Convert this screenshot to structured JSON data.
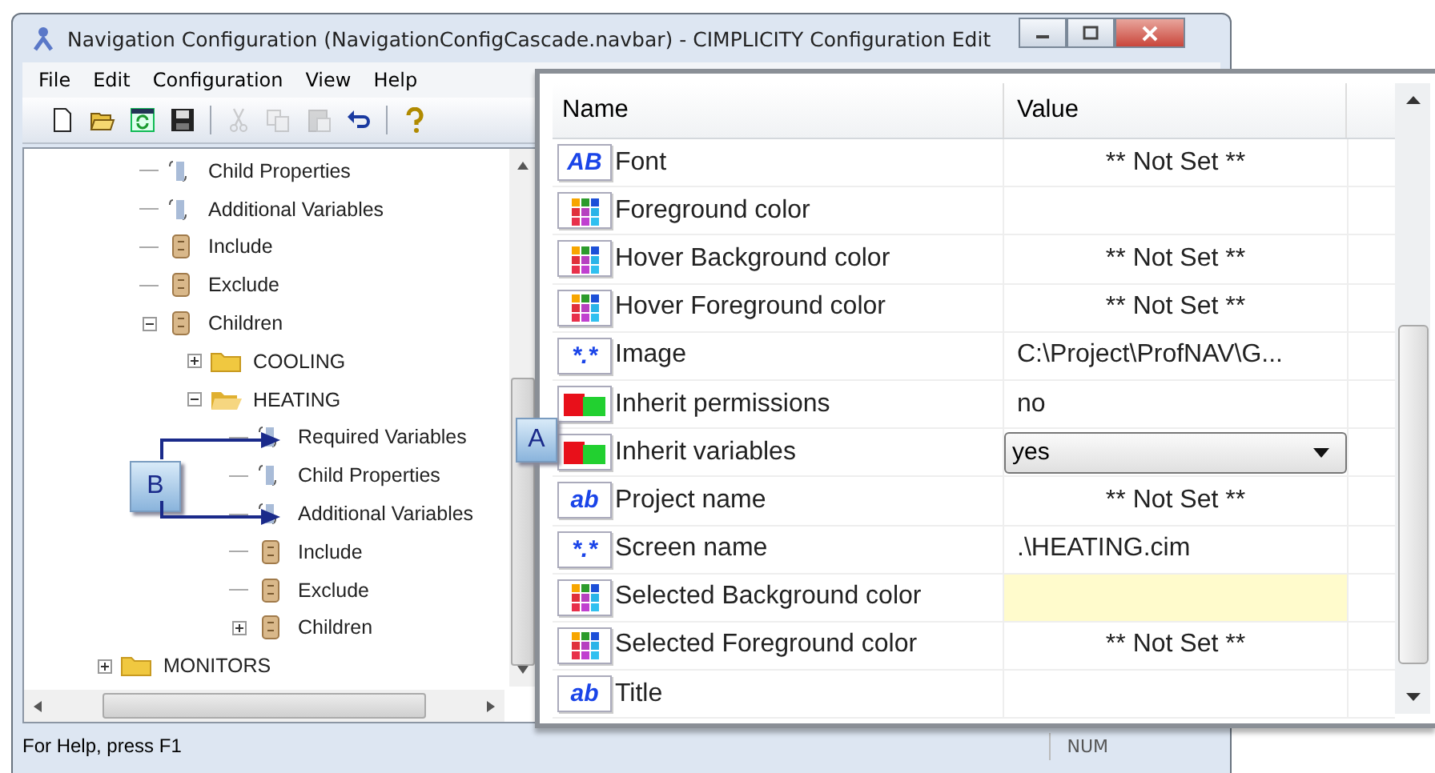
{
  "window": {
    "title": "Navigation Configuration (NavigationConfigCascade.navbar) - CIMPLICITY Configuration Edit"
  },
  "menu": [
    "File",
    "Edit",
    "Configuration",
    "View",
    "Help"
  ],
  "toolbar": [
    {
      "kind": "new",
      "disabled": false
    },
    {
      "kind": "open",
      "disabled": false
    },
    {
      "kind": "refresh",
      "disabled": false
    },
    {
      "kind": "save",
      "disabled": false
    },
    {
      "kind": "separator"
    },
    {
      "kind": "cut",
      "disabled": true
    },
    {
      "kind": "copy",
      "disabled": true
    },
    {
      "kind": "paste",
      "disabled": true
    },
    {
      "kind": "undo",
      "disabled": false
    },
    {
      "kind": "separator"
    },
    {
      "kind": "help",
      "disabled": false
    }
  ],
  "tree": {
    "scrolled_branch": [
      {
        "label": "Child Properties",
        "kind": "variables"
      },
      {
        "label": "Additional Variables",
        "kind": "variables"
      },
      {
        "label": "Include",
        "kind": "list"
      },
      {
        "label": "Exclude",
        "kind": "list"
      },
      {
        "label": "Children",
        "kind": "list",
        "expanded": true,
        "children": [
          {
            "label": "COOLING",
            "kind": "folder",
            "expanded": false
          },
          {
            "label": "HEATING",
            "kind": "folder",
            "expanded": true,
            "children": [
              {
                "label": "Required Variables",
                "kind": "variables"
              },
              {
                "label": "Child Properties",
                "kind": "variables"
              },
              {
                "label": "Additional Variables",
                "kind": "variables"
              },
              {
                "label": "Include",
                "kind": "list"
              },
              {
                "label": "Exclude",
                "kind": "list"
              },
              {
                "label": "Children",
                "kind": "list",
                "expanded": false
              }
            ]
          }
        ]
      }
    ],
    "items": [
      {
        "label": "MONITORS",
        "kind": "folder",
        "expanded": false
      }
    ]
  },
  "status_bar": {
    "message": "For Help, press F1",
    "indicator": "NUM"
  },
  "properties": {
    "columns": [
      "Name",
      "Value"
    ],
    "rows": [
      {
        "kind": "text",
        "icon_label": "AB",
        "name": "Font",
        "value": "** Not Set **",
        "default": true
      },
      {
        "kind": "color",
        "name": "Foreground color"
      },
      {
        "kind": "color",
        "name": "Hover Background color",
        "value": "** Not Set **",
        "default": true
      },
      {
        "kind": "color",
        "name": "Hover Foreground color",
        "value": "** Not Set **",
        "default": true
      },
      {
        "kind": "text",
        "icon_label": "*.*",
        "name": "Image",
        "value": "C:\\Project\\ProfNAV\\G...",
        "default": false
      },
      {
        "kind": "boolean",
        "name": "Inherit permissions",
        "value": "no",
        "default": false
      },
      {
        "kind": "boolean",
        "name": "Inherit variables",
        "value": "yes",
        "editing": true
      },
      {
        "kind": "text",
        "icon_label": "ab",
        "name": "Project name",
        "value": "** Not Set **",
        "default": true
      },
      {
        "kind": "text",
        "icon_label": "*.*",
        "name": "Screen name",
        "value": ".\\HEATING.cim",
        "default": false
      },
      {
        "kind": "color",
        "name": "Selected Background color",
        "color": "#fffbcc"
      },
      {
        "kind": "color",
        "name": "Selected Foreground color",
        "value": "** Not Set **",
        "default": true
      },
      {
        "kind": "text",
        "icon_label": "ab",
        "name": "Title"
      }
    ]
  },
  "callouts": [
    {
      "label": "B"
    },
    {
      "label": "A"
    }
  ]
}
